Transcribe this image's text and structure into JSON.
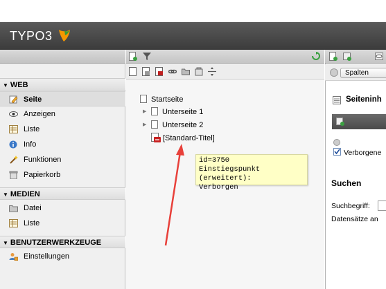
{
  "app": {
    "logo_text": "TYPO3"
  },
  "module_menu": {
    "groups": [
      {
        "title": "WEB",
        "items": [
          {
            "label": "Seite",
            "icon": "page-edit-icon"
          },
          {
            "label": "Anzeigen",
            "icon": "eye-icon"
          },
          {
            "label": "Liste",
            "icon": "list-icon"
          },
          {
            "label": "Info",
            "icon": "info-icon"
          },
          {
            "label": "Funktionen",
            "icon": "wand-icon"
          },
          {
            "label": "Papierkorb",
            "icon": "trash-icon"
          }
        ]
      },
      {
        "title": "MEDIEN",
        "items": [
          {
            "label": "Datei",
            "icon": "folder-icon"
          },
          {
            "label": "Liste",
            "icon": "list-icon"
          }
        ]
      },
      {
        "title": "BENUTZERWERKZEUGE",
        "items": [
          {
            "label": "Einstellungen",
            "icon": "user-settings-icon"
          }
        ]
      }
    ]
  },
  "page_tree": {
    "nodes": [
      {
        "label": "Startseite"
      },
      {
        "label": "Unterseite 1"
      },
      {
        "label": "Unterseite 2"
      },
      {
        "label": "[Standard-Titel]"
      }
    ],
    "tooltip": {
      "line1": "id=3750",
      "line2": "Einstiegspunkt (erweitert):",
      "line3": "Verborgen"
    }
  },
  "content": {
    "view_select": "Spalten",
    "heading": "Seiteninh",
    "hidden_label": "Verborgene",
    "search_heading": "Suchen",
    "search_label": "Suchbegriff:",
    "records_label": "Datensätze an"
  },
  "colors": {
    "header": "#4a4a4a",
    "tooltip": "#ffffc6",
    "arrow": "#e8403a"
  }
}
